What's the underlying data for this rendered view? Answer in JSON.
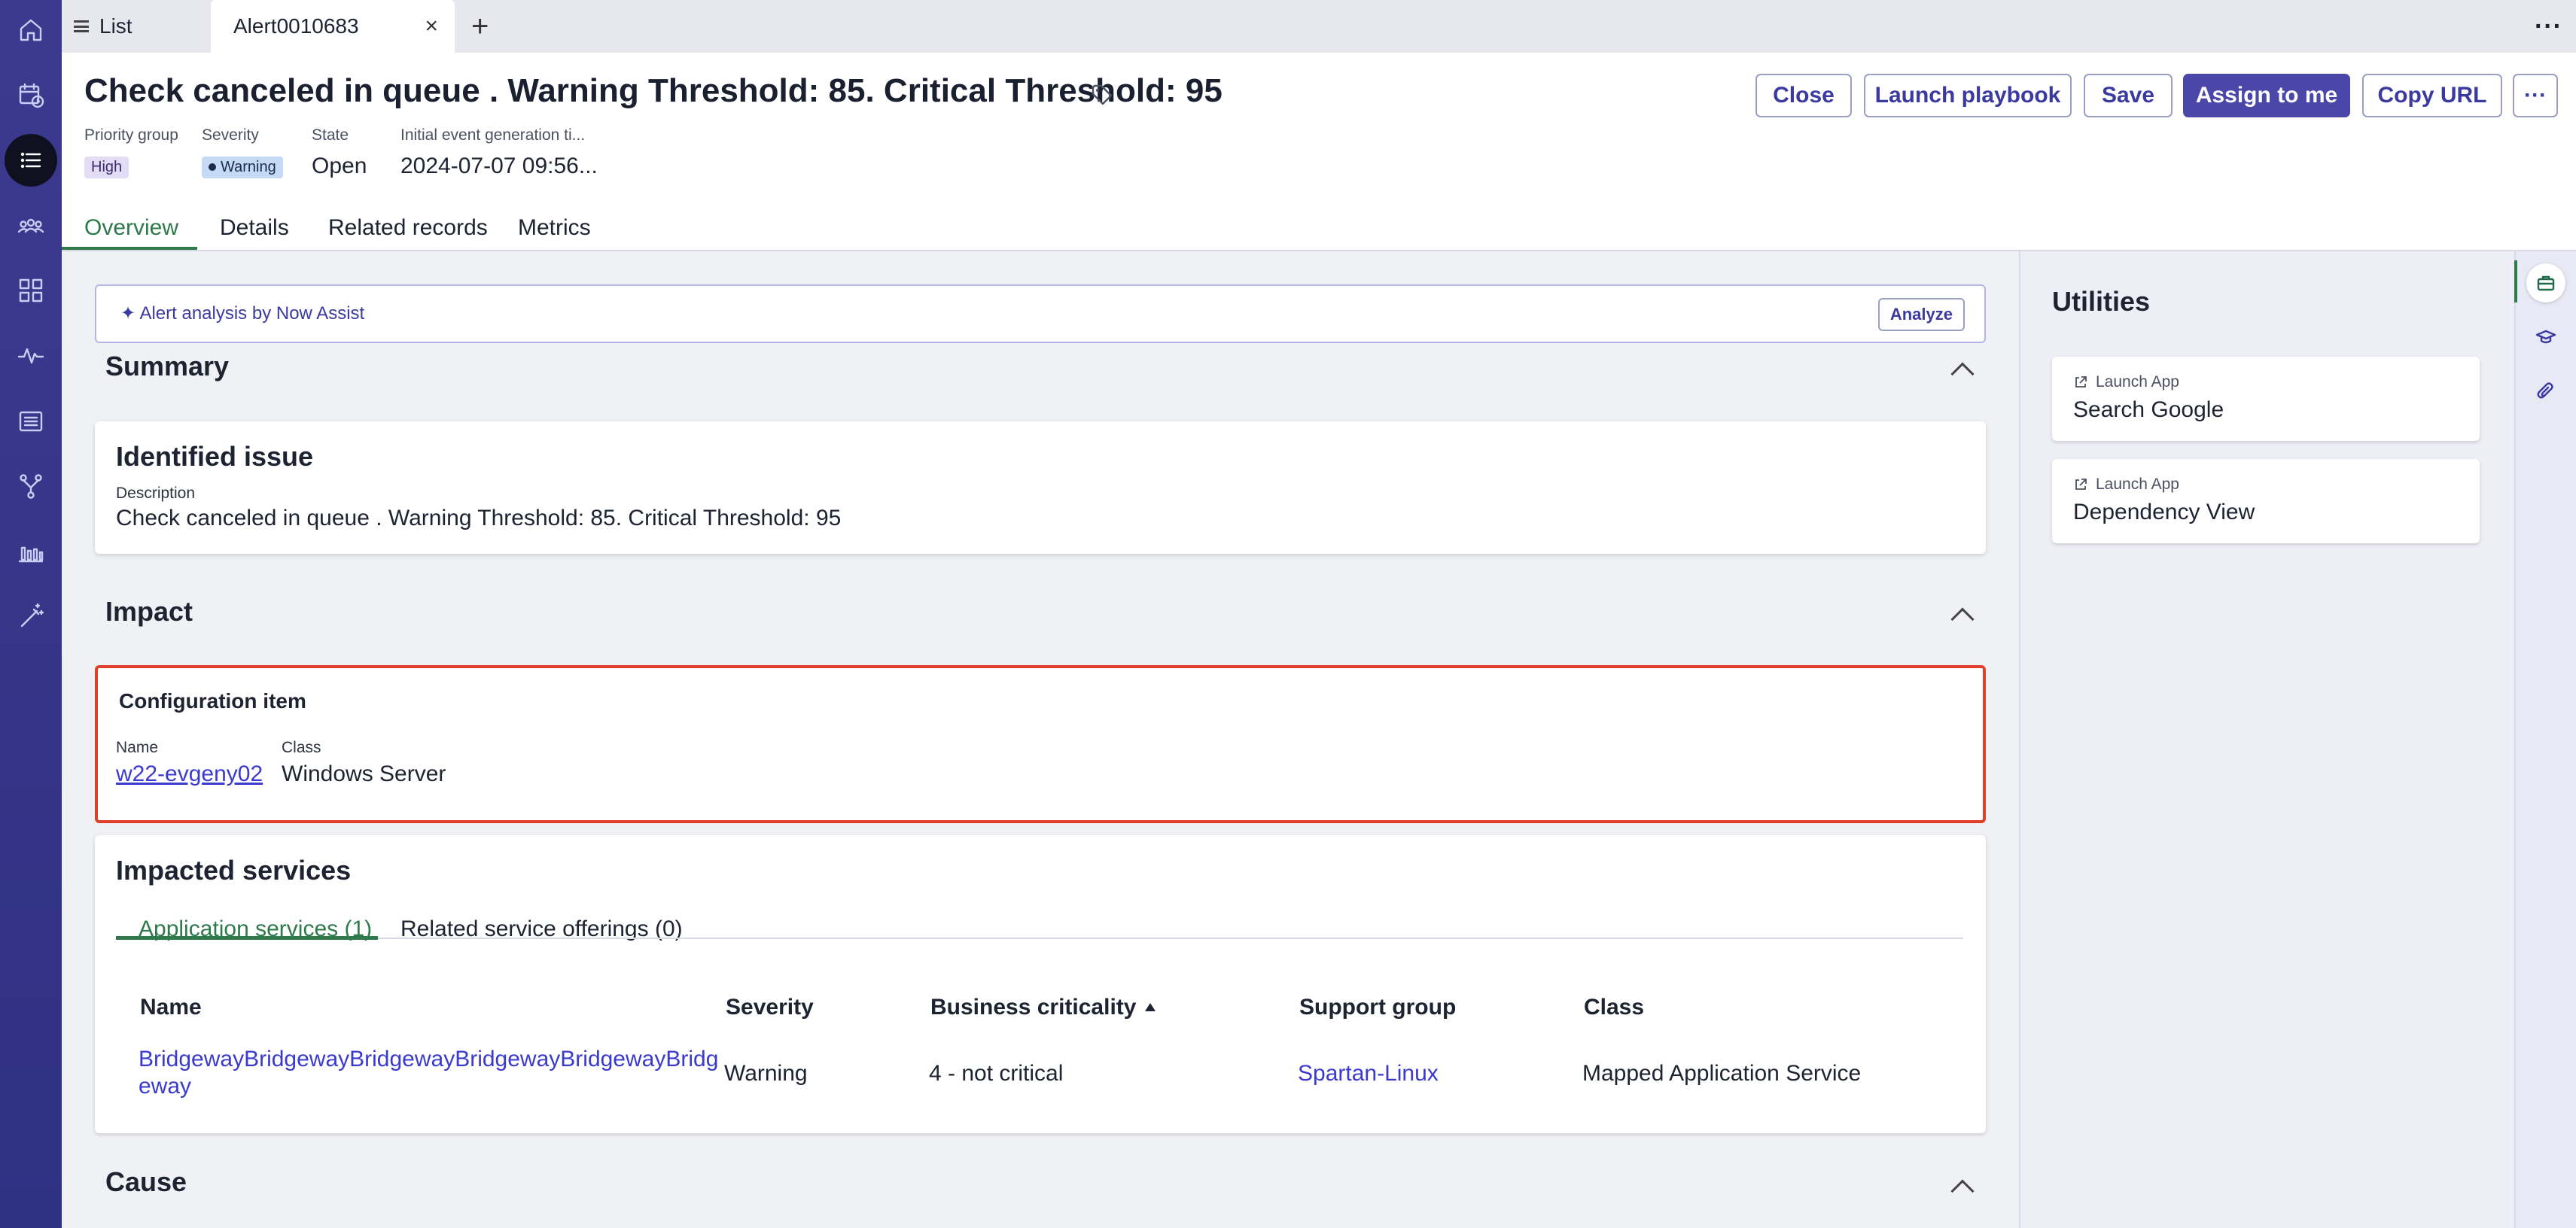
{
  "tabs": {
    "list_label": "List",
    "alert_label": "Alert0010683",
    "close_glyph": "×",
    "add_glyph": "+",
    "more_glyph": "···"
  },
  "header": {
    "title": "Check canceled in queue . Warning Threshold: 85. Critical Threshold: 95",
    "fields": {
      "priority_group": {
        "label": "Priority group",
        "value": "High"
      },
      "severity": {
        "label": "Severity",
        "value": "Warning"
      },
      "state": {
        "label": "State",
        "value": "Open"
      },
      "initial_event": {
        "label": "Initial event generation ti...",
        "value": "2024-07-07 09:56..."
      }
    },
    "buttons": {
      "close": "Close",
      "launch_playbook": "Launch playbook",
      "save": "Save",
      "assign_to_me": "Assign to me",
      "copy_url": "Copy URL",
      "more": "···"
    }
  },
  "subtabs": {
    "overview": "Overview",
    "details": "Details",
    "related_records": "Related records",
    "metrics": "Metrics"
  },
  "assist": {
    "label": "Alert analysis by Now Assist",
    "button": "Analyze"
  },
  "summary": {
    "title": "Summary",
    "identified_issue": {
      "title": "Identified issue",
      "description_label": "Description",
      "description_value": "Check canceled in queue . Warning Threshold: 85. Critical Threshold: 95"
    }
  },
  "impact": {
    "title": "Impact",
    "configuration_item": {
      "title": "Configuration item",
      "name_label": "Name",
      "name_value": "w22-evgeny02",
      "class_label": "Class",
      "class_value": "Windows Server"
    },
    "impacted_services": {
      "title": "Impacted services",
      "tabs": [
        "Application services (1)",
        "Related service offerings (0)"
      ],
      "columns": [
        "Name",
        "Severity",
        "Business criticality",
        "Support group",
        "Class"
      ],
      "rows": [
        {
          "name_line1": "BridgewayBridgewayBridgewayBridgewayBridgewayBridg",
          "name_line2": "eway",
          "severity": "Warning",
          "business_criticality": "4 - not critical",
          "support_group": "Spartan-Linux",
          "class": "Mapped Application Service"
        }
      ]
    }
  },
  "cause": {
    "title": "Cause"
  },
  "utilities": {
    "title": "Utilities",
    "items": [
      {
        "sub": "Launch App",
        "name": "Search Google"
      },
      {
        "sub": "Launch App",
        "name": "Dependency View"
      }
    ]
  },
  "colors": {
    "rail": "#35358a",
    "accent": "#4b47a8",
    "active_tab": "#2f7a4a",
    "highlight_border": "#e0402a"
  }
}
